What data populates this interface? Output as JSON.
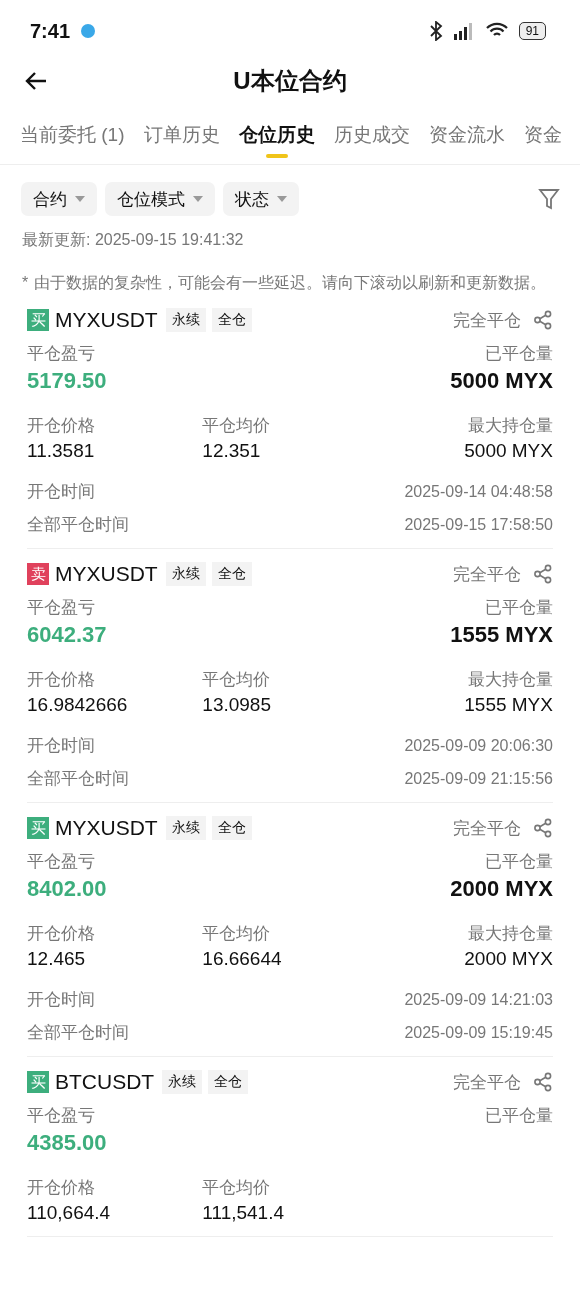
{
  "status_bar": {
    "time": "7:41",
    "battery": "91"
  },
  "header": {
    "title": "U本位合约"
  },
  "tabs": [
    {
      "label": "当前委托 (1)",
      "selected": false
    },
    {
      "label": "订单历史",
      "selected": false
    },
    {
      "label": "仓位历史",
      "selected": true
    },
    {
      "label": "历史成交",
      "selected": false
    },
    {
      "label": "资金流水",
      "selected": false
    },
    {
      "label": "资金",
      "selected": false
    }
  ],
  "filters": [
    "合约",
    "仓位模式",
    "状态"
  ],
  "last_update": "最新更新: 2025-09-15 19:41:32",
  "note_mark": "*",
  "note": "由于数据的复杂性，可能会有一些延迟。请向下滚动以刷新和更新数据。",
  "positions": [
    {
      "side": "买",
      "kind": "buy",
      "symbol": "MYXUSDT",
      "tags": [
        "永续",
        "全仓"
      ],
      "status": "完全平仓",
      "pnl_label": "平仓盈亏",
      "pnl": "5179.50",
      "closed_label": "已平仓量",
      "closed": "5000 MYX",
      "open_price_label": "开仓价格",
      "open_price": "11.3581",
      "close_avg_label": "平仓均价",
      "close_avg": "12.351",
      "max_label": "最大持仓量",
      "max": "5000 MYX",
      "open_time_label": "开仓时间",
      "open_time": "2025-09-14 04:48:58",
      "close_time_label": "全部平仓时间",
      "close_time": "2025-09-15 17:58:50"
    },
    {
      "side": "卖",
      "kind": "sell",
      "symbol": "MYXUSDT",
      "tags": [
        "永续",
        "全仓"
      ],
      "status": "完全平仓",
      "pnl_label": "平仓盈亏",
      "pnl": "6042.37",
      "closed_label": "已平仓量",
      "closed": "1555 MYX",
      "open_price_label": "开仓价格",
      "open_price": "16.9842666",
      "close_avg_label": "平仓均价",
      "close_avg": "13.0985",
      "max_label": "最大持仓量",
      "max": "1555 MYX",
      "open_time_label": "开仓时间",
      "open_time": "2025-09-09 20:06:30",
      "close_time_label": "全部平仓时间",
      "close_time": "2025-09-09 21:15:56"
    },
    {
      "side": "买",
      "kind": "buy",
      "symbol": "MYXUSDT",
      "tags": [
        "永续",
        "全仓"
      ],
      "status": "完全平仓",
      "pnl_label": "平仓盈亏",
      "pnl": "8402.00",
      "closed_label": "已平仓量",
      "closed": "2000 MYX",
      "open_price_label": "开仓价格",
      "open_price": "12.465",
      "close_avg_label": "平仓均价",
      "close_avg": "16.66644",
      "max_label": "最大持仓量",
      "max": "2000 MYX",
      "open_time_label": "开仓时间",
      "open_time": "2025-09-09 14:21:03",
      "close_time_label": "全部平仓时间",
      "close_time": "2025-09-09 15:19:45"
    },
    {
      "side": "买",
      "kind": "buy",
      "symbol": "BTCUSDT",
      "tags": [
        "永续",
        "全仓"
      ],
      "status": "完全平仓",
      "pnl_label": "平仓盈亏",
      "pnl": "4385.00",
      "closed_label": "已平仓量",
      "open_price_label": "开仓价格",
      "open_price": "110,664.4",
      "close_avg_label": "平仓均价",
      "close_avg": "111,541.4"
    }
  ]
}
